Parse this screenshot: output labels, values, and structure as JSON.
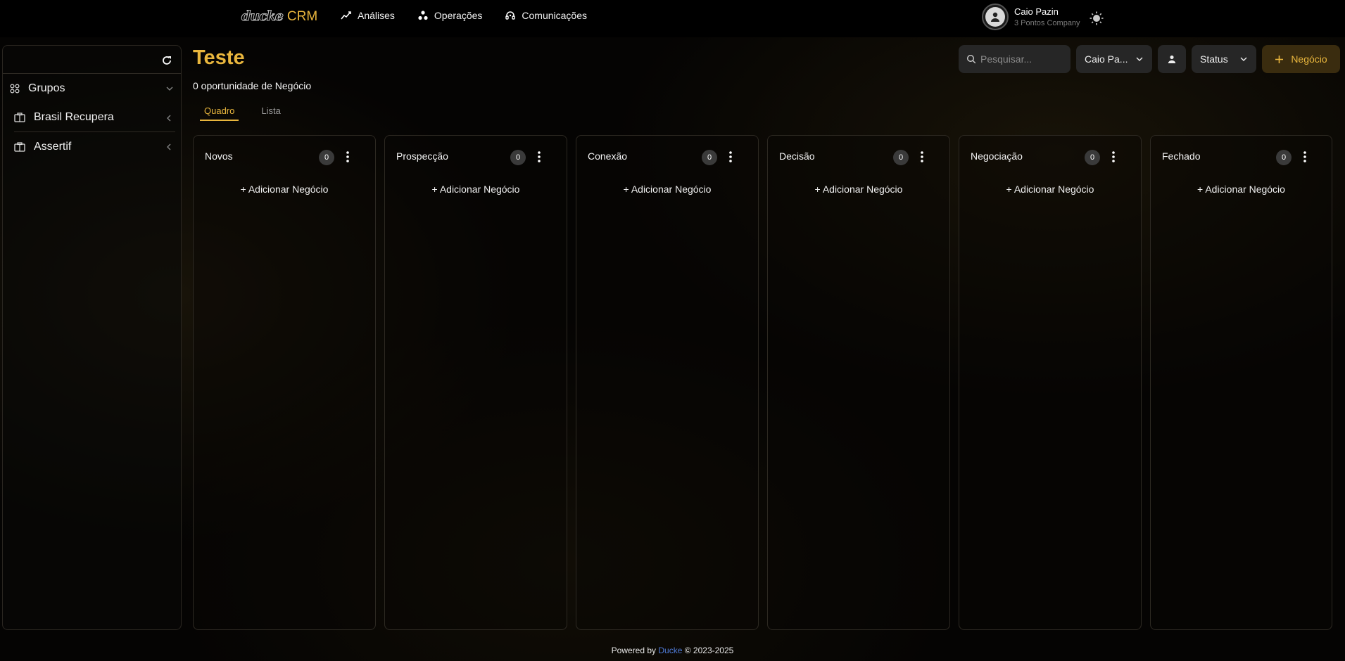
{
  "header": {
    "logo_text": "ducke",
    "app_name": "CRM",
    "nav": [
      {
        "label": "Análises",
        "icon": "chart-line-icon"
      },
      {
        "label": "Operações",
        "icon": "nodes-icon"
      },
      {
        "label": "Comunicações",
        "icon": "headset-icon"
      }
    ],
    "user": {
      "name": "Caio Pazin",
      "company": "3 Pontos Company"
    }
  },
  "sidebar": {
    "groups_label": "Grupos",
    "items": [
      {
        "label": "Brasil Recupera",
        "icon": "building-icon"
      },
      {
        "label": "Assertif",
        "icon": "building-icon"
      }
    ]
  },
  "page": {
    "title": "Teste",
    "subtitle": "0 oportunidade de Negócio",
    "tabs": [
      {
        "label": "Quadro",
        "active": true
      },
      {
        "label": "Lista",
        "active": false
      }
    ]
  },
  "toolbar": {
    "search_placeholder": "Pesquisar...",
    "owner_filter": "Caio Pa...",
    "status_filter": "Status",
    "new_button": "Negócio"
  },
  "board": {
    "add_label": "+ Adicionar Negócio",
    "columns": [
      {
        "title": "Novos",
        "count": "0"
      },
      {
        "title": "Prospecção",
        "count": "0"
      },
      {
        "title": "Conexão",
        "count": "0"
      },
      {
        "title": "Decisão",
        "count": "0"
      },
      {
        "title": "Negociação",
        "count": "0"
      },
      {
        "title": "Fechado",
        "count": "0"
      }
    ]
  },
  "footer": {
    "prefix": "Powered by",
    "brand": "Ducke",
    "suffix": "© 2023-2025"
  },
  "colors": {
    "accent": "#e9b63d",
    "background": "#050403",
    "link": "#4f7bd8"
  }
}
